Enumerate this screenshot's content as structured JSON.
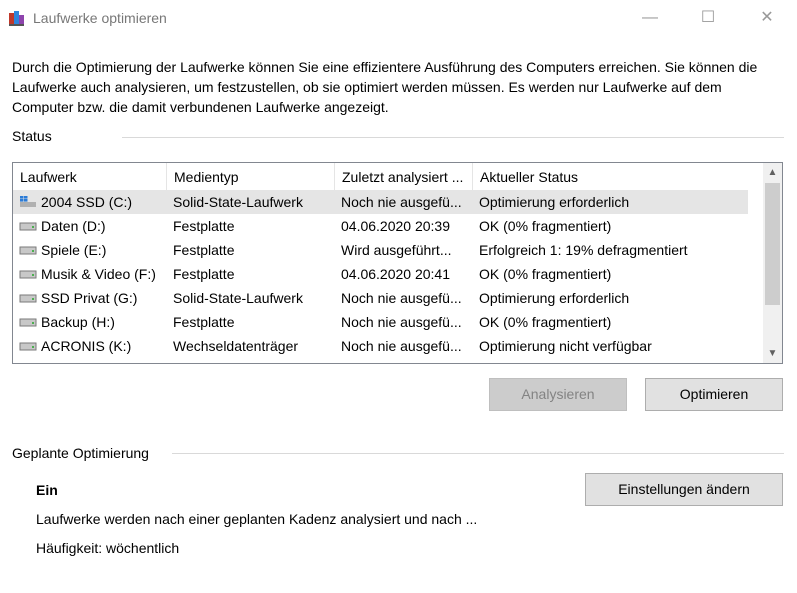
{
  "window": {
    "title": "Laufwerke optimieren",
    "minimize_glyph": "—",
    "maximize_glyph": "☐",
    "close_glyph": "✕"
  },
  "intro_text": "Durch die Optimierung der Laufwerke können Sie eine effizientere Ausführung des Computers erreichen. Sie können die Laufwerke auch analysieren, um festzustellen, ob sie optimiert werden müssen. Es werden nur Laufwerke auf dem Computer bzw. die damit verbundenen Laufwerke angezeigt.",
  "status_section": {
    "label": "Status",
    "columns": [
      "Laufwerk",
      "Medientyp",
      "Zuletzt analysiert ...",
      "Aktueller Status"
    ],
    "rows": [
      {
        "drive": "2004 SSD (C:)",
        "media": "Solid-State-Laufwerk",
        "last": "Noch nie ausgefü...",
        "status": "Optimierung erforderlich",
        "icon": "windows-drive-icon",
        "selected": true
      },
      {
        "drive": "Daten (D:)",
        "media": "Festplatte",
        "last": "04.06.2020 20:39",
        "status": "OK (0% fragmentiert)",
        "icon": "hard-drive-icon",
        "selected": false
      },
      {
        "drive": "Spiele (E:)",
        "media": "Festplatte",
        "last": "Wird ausgeführt...",
        "status": "Erfolgreich 1: 19% defragmentiert",
        "icon": "hard-drive-icon",
        "selected": false
      },
      {
        "drive": "Musik & Video (F:)",
        "media": "Festplatte",
        "last": "04.06.2020 20:41",
        "status": "OK (0% fragmentiert)",
        "icon": "hard-drive-icon",
        "selected": false
      },
      {
        "drive": "SSD Privat (G:)",
        "media": "Solid-State-Laufwerk",
        "last": "Noch nie ausgefü...",
        "status": "Optimierung erforderlich",
        "icon": "hard-drive-icon",
        "selected": false
      },
      {
        "drive": "Backup (H:)",
        "media": "Festplatte",
        "last": "Noch nie ausgefü...",
        "status": "OK (0% fragmentiert)",
        "icon": "hard-drive-icon",
        "selected": false
      },
      {
        "drive": "ACRONIS (K:)",
        "media": "Wechseldatenträger",
        "last": "Noch nie ausgefü...",
        "status": "Optimierung nicht verfügbar",
        "icon": "removable-drive-icon",
        "selected": false
      }
    ],
    "analyze_label": "Analysieren",
    "optimize_label": "Optimieren"
  },
  "scheduled_section": {
    "label": "Geplante Optimierung",
    "state": "Ein",
    "description": "Laufwerke werden nach einer geplanten Kadenz analysiert und nach ...",
    "frequency": "Häufigkeit: wöchentlich",
    "settings_label": "Einstellungen ändern"
  },
  "colors": {
    "selection": "#e5e5e5",
    "windows_blue": "#2b7bd6",
    "button_face": "#e1e1e1",
    "disabled_text": "#838383"
  }
}
